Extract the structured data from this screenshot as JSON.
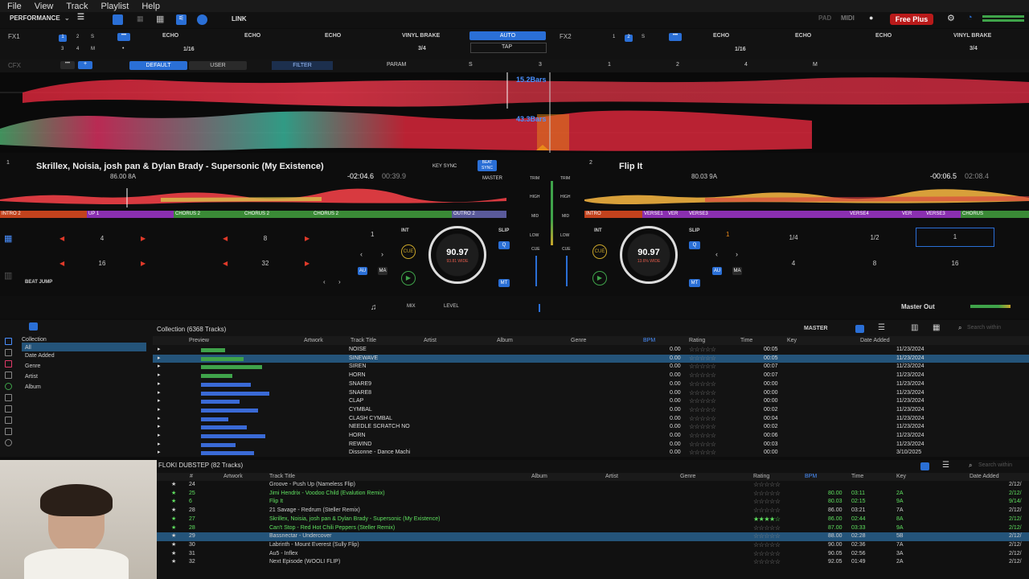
{
  "menu": [
    "File",
    "View",
    "Track",
    "Playlist",
    "Help"
  ],
  "toolbar": {
    "mode": "PERFORMANCE",
    "link": "LINK",
    "pad": "PAD",
    "midi": "MIDI",
    "free_plus": "Free Plus"
  },
  "fx1": {
    "label": "FX1",
    "slots": [
      "ECHO",
      "ECHO",
      "ECHO",
      "VINYL BRAKE"
    ],
    "auto": "AUTO",
    "tap": "TAP",
    "beat": "1/16",
    "beat2": "3/4"
  },
  "fx2": {
    "label": "FX2",
    "slots": [
      "ECHO",
      "ECHO",
      "ECHO",
      "VINYL BRAKE"
    ],
    "beat": "1/16",
    "beat2": "3/4"
  },
  "cfx": {
    "label": "CFX",
    "default": "DEFAULT",
    "user": "USER",
    "filter": "FILTER",
    "param": "PARAM",
    "s": "S",
    "nums": [
      "3",
      "1",
      "2",
      "4"
    ],
    "m": "M"
  },
  "waveform": {
    "bars_top": "15.2Bars",
    "bars_bottom": "43.3Bars"
  },
  "deck1": {
    "num": "1",
    "title": "Skrillex, Noisia, josh pan & Dylan Brady - Supersonic (My Existence)",
    "bpm_key": "86.00 8A",
    "time_remain": "-02:04.6",
    "time_total": "00:39.9",
    "key_sync": "KEY SYNC",
    "beat_sync": "BEAT SYNC",
    "master": "MASTER",
    "bpm": "90.97",
    "bpm_sub": "93.81 WIDE",
    "segments": [
      "INTRO 2",
      "UP 1",
      "CHORUS 2",
      "CHORUS 2",
      "CHORUS 2",
      "OUTRO 2"
    ],
    "pads": [
      "4",
      "8",
      "16",
      "32"
    ],
    "beat_jump": "BEAT JUMP",
    "int": "INT",
    "slip": "SLIP",
    "cue": "CUE",
    "au": "AU",
    "ma": "MA",
    "mt": "MT",
    "one": "1"
  },
  "deck2": {
    "num": "2",
    "title": "Flip It",
    "bpm_key": "80.03 9A",
    "time_remain": "-00:06.5",
    "time_total": "02:08.4",
    "bpm": "90.97",
    "bpm_sub": "13.6% WIDE",
    "segments": [
      "INTRO",
      "VERSE1",
      "VER",
      "VERSE3",
      "VERSE4",
      "VER",
      "VERSE3",
      "CHORUS"
    ],
    "loops": [
      "1/4",
      "1/2",
      "1",
      "4",
      "8",
      "16"
    ],
    "int": "INT",
    "slip": "SLIP",
    "cue": "CUE",
    "au": "AU",
    "ma": "MA",
    "mt": "MT",
    "one": "1"
  },
  "mixer": {
    "trim": "TRIM",
    "high": "HIGH",
    "mid": "MID",
    "low": "LOW",
    "cue": "CUE",
    "mix": "MIX",
    "level": "LEVEL",
    "master_out": "Master Out"
  },
  "browser": {
    "tree": [
      "Collection",
      "All",
      "Date Added",
      "Genre",
      "Artist",
      "Album"
    ],
    "collection_title": "Collection (6368 Tracks)",
    "columns": [
      "Preview",
      "Artwork",
      "Track Title",
      "Artist",
      "Album",
      "Genre",
      "BPM",
      "Rating",
      "Time",
      "Key",
      "Date Added"
    ],
    "master": "MASTER",
    "search": "Search within",
    "rows": [
      {
        "title": "NOISE",
        "bpm": "0.00",
        "time": "00:05",
        "date": "11/23/2024"
      },
      {
        "title": "SINEWAVE",
        "bpm": "0.00",
        "time": "00:05",
        "date": "11/23/2024"
      },
      {
        "title": "SIREN",
        "bpm": "0.00",
        "time": "00:07",
        "date": "11/23/2024"
      },
      {
        "title": "HORN",
        "bpm": "0.00",
        "time": "00:07",
        "date": "11/23/2024"
      },
      {
        "title": "SNARE9",
        "bpm": "0.00",
        "time": "00:00",
        "date": "11/23/2024"
      },
      {
        "title": "SNARE8",
        "bpm": "0.00",
        "time": "00:00",
        "date": "11/23/2024"
      },
      {
        "title": "CLAP",
        "bpm": "0.00",
        "time": "00:00",
        "date": "11/23/2024"
      },
      {
        "title": "CYMBAL",
        "bpm": "0.00",
        "time": "00:02",
        "date": "11/23/2024"
      },
      {
        "title": "CLASH CYMBAL",
        "bpm": "0.00",
        "time": "00:04",
        "date": "11/23/2024"
      },
      {
        "title": "NEEDLE SCRATCH NO",
        "bpm": "0.00",
        "time": "00:02",
        "date": "11/23/2024"
      },
      {
        "title": "HORN",
        "bpm": "0.00",
        "time": "00:06",
        "date": "11/23/2024"
      },
      {
        "title": "REWIND",
        "bpm": "0.00",
        "time": "00:03",
        "date": "11/23/2024"
      },
      {
        "title": "Dissonne - Dance Machi",
        "bpm": "0.00",
        "time": "00:00",
        "date": "3/10/2025"
      }
    ]
  },
  "playlist": {
    "title": "FLOKI DUBSTEP (82 Tracks)",
    "search": "Search within",
    "columns": [
      "#",
      "Artwork",
      "Track Title",
      "Album",
      "Artist",
      "Genre",
      "Rating",
      "BPM",
      "Time",
      "Key",
      "Date Added"
    ],
    "rows": [
      {
        "n": "24",
        "title": "Groove - Push Up (Nameless Flip)",
        "bpm": "",
        "time": "",
        "key": "",
        "date": "2/12/",
        "green": false
      },
      {
        "n": "25",
        "title": "Jimi Hendrix - Voodoo Child (Evalution Remix)",
        "bpm": "80.00",
        "time": "03:11",
        "key": "2A",
        "date": "2/12/",
        "green": true
      },
      {
        "n": "6",
        "title": "Flip It",
        "bpm": "80.03",
        "time": "02:15",
        "key": "9A",
        "date": "9/14/",
        "green": true
      },
      {
        "n": "28",
        "title": "21 Savage - Redrum (Steller Remix)",
        "bpm": "86.00",
        "time": "03:21",
        "key": "7A",
        "date": "2/12/",
        "green": false
      },
      {
        "n": "27",
        "title": "Skrillex, Noisia, josh pan & Dylan Brady - Supersonic (My Existence)",
        "bpm": "86.00",
        "time": "02:44",
        "key": "8A",
        "date": "2/12/",
        "green": true
      },
      {
        "n": "28",
        "title": "Can't Stop - Red Hot Chili Peppers (Steller Remix)",
        "bpm": "87.00",
        "time": "03:33",
        "key": "9A",
        "date": "2/12/",
        "green": true
      },
      {
        "n": "29",
        "title": "Bassnectar - Undercover",
        "bpm": "88.00",
        "time": "02:28",
        "key": "5B",
        "date": "2/12/",
        "green": false
      },
      {
        "n": "30",
        "title": "Labrinth - Mount Everest (Sully Flip)",
        "bpm": "90.00",
        "time": "02:36",
        "key": "7A",
        "date": "2/12/",
        "green": false
      },
      {
        "n": "31",
        "title": "Au5 - Inflex",
        "bpm": "90.05",
        "time": "02:56",
        "key": "3A",
        "date": "2/12/",
        "green": false
      },
      {
        "n": "32",
        "title": "Next Episode (WOOLI FLIP)",
        "bpm": "92.05",
        "time": "01:49",
        "key": "2A",
        "date": "2/12/",
        "green": false
      }
    ]
  },
  "colors": {
    "accent": "#2a6fd6",
    "red": "#e03a2a",
    "green": "#5fe05f",
    "gold": "#c9a52a"
  }
}
